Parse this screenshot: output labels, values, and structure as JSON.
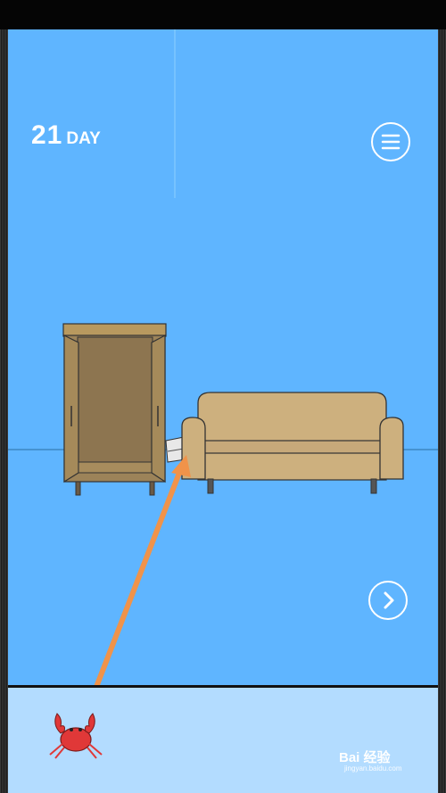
{
  "hud": {
    "day_number": "21",
    "day_label": "DAY"
  },
  "watermark": {
    "brand": "Bai 经验",
    "url": "jingyan.baidu.com"
  },
  "icons": {
    "menu": "hamburger-menu-icon",
    "next": "chevron-right-icon"
  },
  "colors": {
    "wall": "#5fb5ff",
    "tray": "#b3dcff",
    "sofa": "#cdb07e",
    "wardrobe": "#a58a5a",
    "arrow": "#f0934a",
    "crab": "#e03838"
  }
}
